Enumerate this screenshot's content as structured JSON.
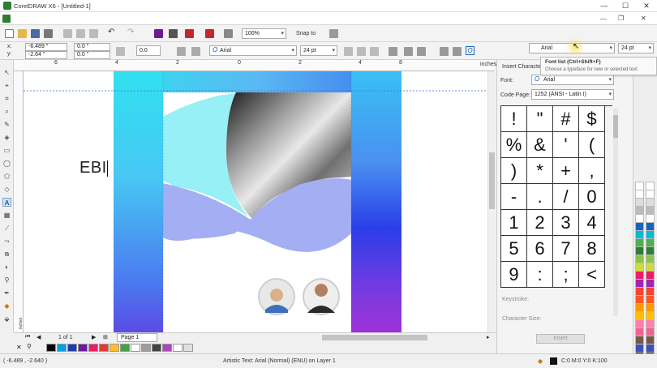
{
  "titlebar": {
    "title": "CorelDRAW X6 - [Untitled-1]",
    "min": "—",
    "max": "☐",
    "close": "✕"
  },
  "toolbar": {
    "zoom": "100%",
    "snap_to": "Snap to"
  },
  "propertybar": {
    "x": "-6.489 \"",
    "y": "-2.64 \"",
    "w": "0.0 \"",
    "h": "0.0 \"",
    "angle": "0.0",
    "font": "Arial",
    "size": "24 pt",
    "font_right": "Arial",
    "size_right": "24 pt"
  },
  "tooltip": {
    "title": "Font list (Ctrl+Shift+F)",
    "desc": "Choose a typeface for new or selected text"
  },
  "ruler": {
    "unit": "inches",
    "ticks": [
      "6",
      "4",
      "2",
      "0",
      "2",
      "4",
      "6",
      "8"
    ],
    "v_label": "inches"
  },
  "canvas": {
    "text": "EBI"
  },
  "docker": {
    "title": "Insert Character",
    "font_label": "Font:",
    "font_value": "Arial",
    "codepage_label": "Code Page:",
    "codepage_value": "1252  (ANSI - Latin I)",
    "chars": [
      "!",
      "\"",
      "#",
      "$",
      "%",
      "&",
      "'",
      "(",
      ")",
      "*",
      "+",
      ",",
      "-",
      ".",
      "/",
      "0",
      "1",
      "2",
      "3",
      "4",
      "5",
      "6",
      "7",
      "8",
      "9",
      ":",
      ";",
      "<"
    ],
    "keystroke_label": "Keystroke:",
    "keystroke_value": "U+0021",
    "charsize_label": "Character Size:",
    "insert_label": "Insert"
  },
  "pagenav": {
    "count": "1 of 1",
    "page": "Page 1"
  },
  "status": {
    "coords": "( -6.489 , -2.640 )",
    "info": "Artistic Text: Arial (Normal) (ENU) on Layer 1",
    "color": "C:0 M:0 Y:0 K:100"
  },
  "palette_colors": [
    "#000000",
    "#00a0e0",
    "#1e3ca8",
    "#6a1b9a",
    "#e91e63",
    "#e53935",
    "#fbc02d",
    "#43a047",
    "#ffffff",
    "#9e9e9e",
    "#424242",
    "#ab47bc",
    "#ffffff",
    "#e0e0e0"
  ],
  "right_palette_colors": [
    "#ffffff",
    "#ffffff",
    "#dddddd",
    "#bbbbbb",
    "#ffffff",
    "#1565c0",
    "#00bcd4",
    "#4caf50",
    "#2e7d32",
    "#8bc34a",
    "#cddc39",
    "#e91e63",
    "#9c27b0",
    "#f44336",
    "#ff5722",
    "#ff9800",
    "#ffc107",
    "#ff80ab",
    "#f06292",
    "#795548",
    "#3f51b5",
    "#000000"
  ]
}
